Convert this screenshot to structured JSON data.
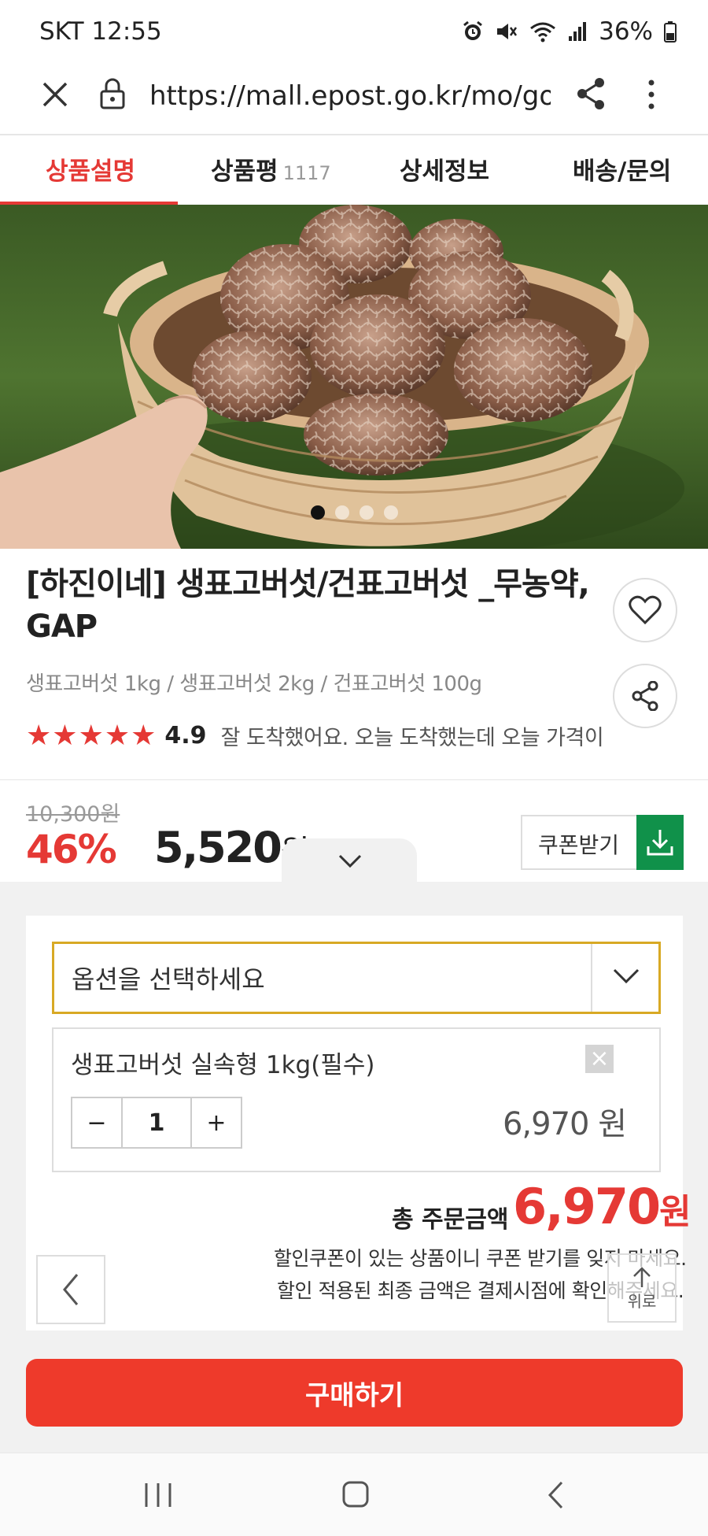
{
  "status_bar": {
    "carrier_time": "SKT 12:55",
    "battery": "36%",
    "icons": [
      "alarm-icon",
      "mute-icon",
      "wifi-icon",
      "signal-icon",
      "battery-icon"
    ]
  },
  "browser": {
    "url": "https://mall.epost.go.kr/mo/gooc",
    "icons": [
      "close-icon",
      "lock-icon",
      "share-icon",
      "more-icon"
    ]
  },
  "tabs": [
    {
      "label": "상품설명",
      "active": true
    },
    {
      "label": "상품평",
      "count": "1117"
    },
    {
      "label": "상세정보"
    },
    {
      "label": "배송/문의"
    }
  ],
  "product": {
    "title": "[하진이네] 생표고버섯/건표고버섯 _무농약, GAP",
    "subtitle": "생표고버섯 1kg / 생표고버섯 2kg / 건표고버섯 100g",
    "stars": 5,
    "rating": "4.9",
    "review_snippet": "잘 도착했어요. 오늘 도착했는데 오늘 가격이 훅 떨",
    "original_price": "10,300원",
    "discount": "46%",
    "sale_price": "5,520",
    "sale_price_unit": "원",
    "coupon_label": "쿠폰받기",
    "image_carousel": {
      "total": 4,
      "active": 1
    }
  },
  "order": {
    "select_placeholder": "옵션을 선택하세요",
    "selected_option": {
      "name": "생표고버섯 실속형 1kg(필수)",
      "qty": "1",
      "minus": "−",
      "plus": "+",
      "remove": "×",
      "price": "6,970 원"
    },
    "total_label": "총 주문금액",
    "total_price": "6,970",
    "total_unit": "원",
    "notice_line1": "할인쿠폰이 있는 상품이니 쿠폰 받기를 잊지 마세요.",
    "notice_line2": "할인 적용된 최종 금액은 결제시점에 확인해주세요.",
    "top_label": "위로",
    "buy_label": "구매하기"
  },
  "colors": {
    "accent_red": "#e53935",
    "coupon_green": "#10914a",
    "select_border": "#d8a924",
    "buy_button": "#ee3a2b"
  }
}
